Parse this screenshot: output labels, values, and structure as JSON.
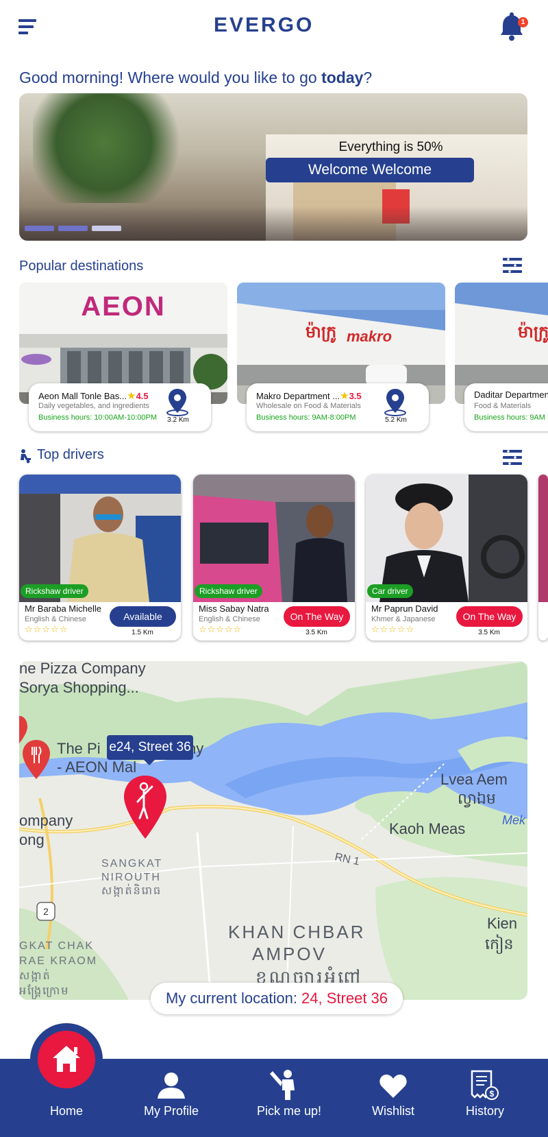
{
  "header": {
    "logo": "EVERGO",
    "notification_count": "1"
  },
  "greeting": {
    "text": "Good morning! Where would you like to go ",
    "bold": "today",
    "end": "?"
  },
  "banner": {
    "line": "Everything is 50%",
    "button": "Welcome Welcome"
  },
  "popular": {
    "title": "Popular destinations",
    "items": [
      {
        "name": "Aeon Mall Tonle Bas...",
        "rating": "4.5",
        "desc": "Daily vegetables, and ingredients",
        "hours": "Business hours: 10:00AM-10:00PM",
        "distance": "3.2 Km"
      },
      {
        "name": "Makro Department ...",
        "rating": "3.5",
        "desc": "Wholesale on Food & Materials",
        "hours": "Business hours: 9AM-8:00PM",
        "distance": "5.2 Km"
      },
      {
        "name": "Daditar Department",
        "rating": "",
        "desc": "Food & Materials",
        "hours": "Business hours: 9AM",
        "distance": ""
      }
    ]
  },
  "drivers": {
    "title": "Top drivers",
    "items": [
      {
        "role": "Rickshaw driver",
        "name": "Mr Baraba Michelle",
        "lang": "English & Chinese",
        "status": "Available",
        "status_color": "#26408f",
        "distance": "1.5 Km",
        "stars": "☆☆☆☆☆"
      },
      {
        "role": "Rickshaw driver",
        "name": "Miss Sabay Natra",
        "lang": "English & Chinese",
        "status": "On The Way",
        "status_color": "#e8183f",
        "distance": "3.5 Km",
        "stars": "☆☆☆☆☆"
      },
      {
        "role": "Car driver",
        "name": "Mr Paprun David",
        "lang": "Khmer & Japanese",
        "status": "On The Way",
        "status_color": "#e8183f",
        "distance": "3.5 Km",
        "stars": "☆☆☆☆☆"
      }
    ]
  },
  "map": {
    "pin_label": "e24, Street 36",
    "labels": {
      "l1": "ne Pizza Company",
      "l2": "Sorya Shopping...",
      "l3": "The Pi",
      "l3b": "ny",
      "l4": "- AEON Mal",
      "l5": "ompany",
      "l6": "ong",
      "l7": "Lvea Aem",
      "l8": "ល្វាឯម",
      "l9": "Kaoh Meas",
      "l10": "SANGKAT",
      "l11": "NIROUTH",
      "l12": "សង្កាត់និរោធ",
      "l13": "RN 1",
      "l14": "2",
      "l15": "KHAN CHBAR",
      "l16": "AMPOV",
      "l17": "ខណ្ឌច្បារអំពៅ",
      "l18": "GKAT CHAK",
      "l19": "RAE KRAOM",
      "l20": "សង្កាត់",
      "l21": "អង្គ្រែក្រោម",
      "l22": "Kien",
      "l23": "កៀន",
      "l24": "Mek"
    },
    "current_label": "My current location: ",
    "current_value": "24, Street 36"
  },
  "nav": {
    "items": [
      "Home",
      "My Profile",
      "Pick me up!",
      "Wishlist",
      "History"
    ]
  },
  "colors": {
    "brand": "#26408f",
    "accent": "#e8183f",
    "green": "#1c9e25",
    "star": "#f2c400"
  }
}
